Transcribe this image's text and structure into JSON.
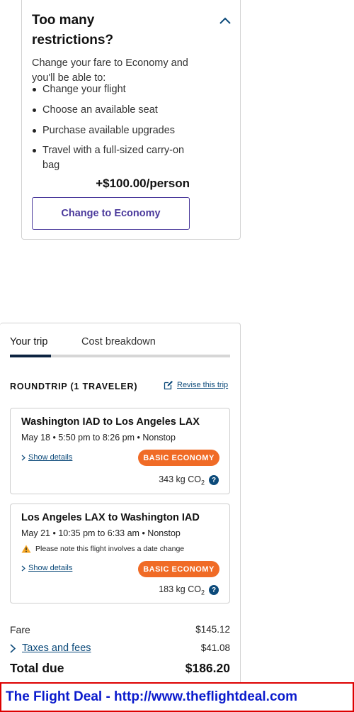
{
  "restrictions": {
    "title": "Too many restrictions?",
    "description": "Change your fare to Economy and you'll be able to:",
    "benefits": [
      "Change your flight",
      "Choose an available seat",
      "Purchase available upgrades",
      "Travel with a full-sized carry-on bag"
    ],
    "price": "+$100.00/person",
    "button_label": "Change to Economy"
  },
  "tabs": [
    "Your trip",
    "Cost breakdown"
  ],
  "trip": {
    "header": "ROUNDTRIP (1 TRAVELER)",
    "revise_label": "Revise this trip",
    "flights": [
      {
        "route": "Washington IAD to Los Angeles LAX",
        "times": "May 18 • 5:50 pm to 8:26 pm • Nonstop",
        "details_label": "Show details",
        "fare_class": "BASIC ECONOMY",
        "co2": "343 kg CO",
        "co2_sub": "2"
      },
      {
        "route": "Los Angeles LAX to Washington IAD",
        "times": "May 21 • 10:35 pm to 6:33 am • Nonstop",
        "notice": "Please note this flight involves a date change",
        "details_label": "Show details",
        "fare_class": "BASIC ECONOMY",
        "co2": "183 kg CO",
        "co2_sub": "2"
      }
    ]
  },
  "costs": {
    "fare_label": "Fare",
    "fare_value": "$145.12",
    "taxes_label": "Taxes and fees",
    "taxes_value": "$41.08",
    "total_label": "Total due",
    "total_value": "$186.20"
  },
  "watermark": "The Flight Deal - http://www.theflightdeal.com",
  "icons": {
    "collapse": "chevron-up-icon",
    "revise": "edit-icon",
    "details": "chevron-right-icon",
    "warning": "warning-icon",
    "help": "help-icon"
  },
  "colors": {
    "accent_purple": "#4b3a9c",
    "link_blue": "#0c4a7a",
    "badge_orange": "#f06b26",
    "tab_indicator": "#0c2340",
    "watermark_blue": "#0a1acc",
    "watermark_border": "#dd0000"
  }
}
